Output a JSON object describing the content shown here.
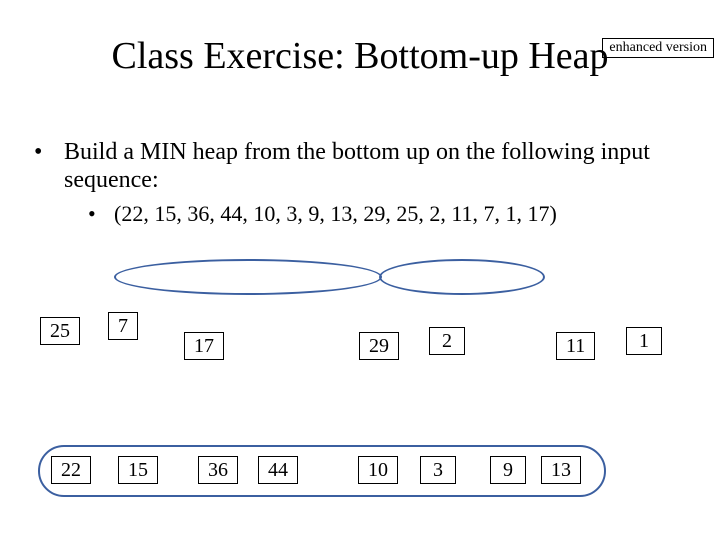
{
  "badge": "enhanced version",
  "title": "Class Exercise: Bottom-up Heap",
  "bullet_main": "Build a MIN heap from the bottom up on the following input sequence:",
  "bullet_sub": "(22, 15, 36, 44, 10, 3, 9, 13, 29, 25, 2, 11, 7, 1, 17)",
  "nodes_row1": {
    "n25": "25",
    "n7": "7",
    "n17": "17",
    "n29": "29",
    "n2": "2",
    "n11": "11",
    "n1": "1"
  },
  "nodes_row2": {
    "n22": "22",
    "n15": "15",
    "n36": "36",
    "n44": "44",
    "n10": "10",
    "n3": "3",
    "n9": "9",
    "n13": "13"
  }
}
